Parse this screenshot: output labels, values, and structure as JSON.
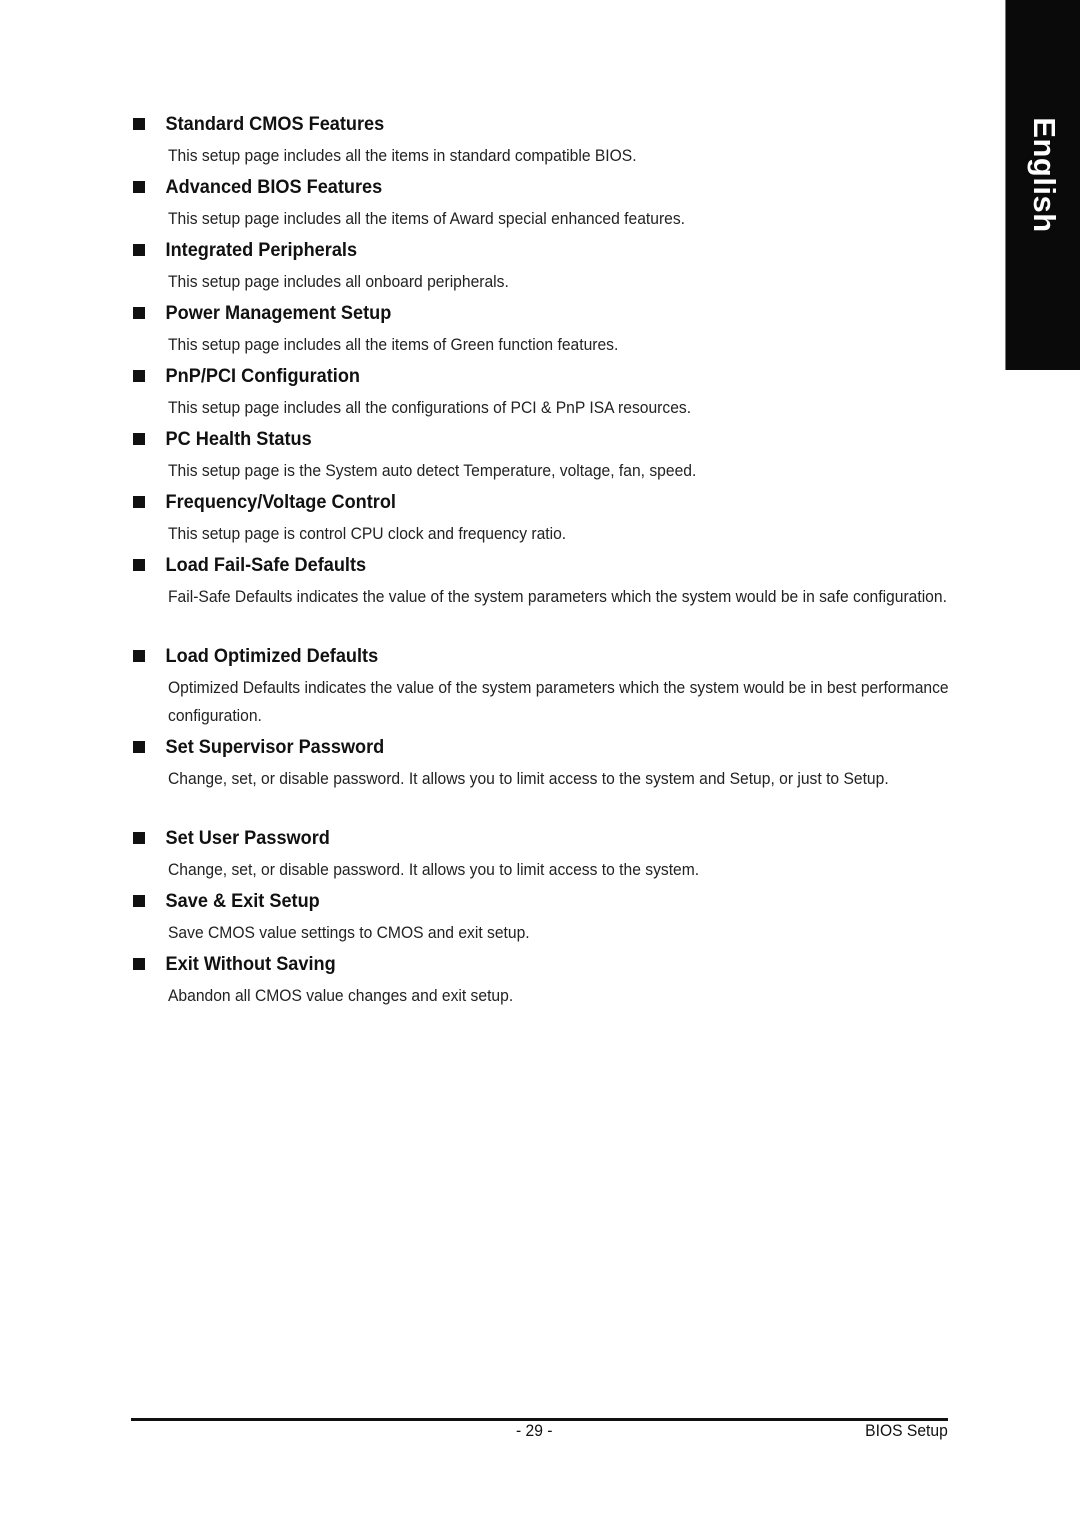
{
  "language_tab": {
    "label": "English"
  },
  "sections": [
    {
      "title": "Standard CMOS Features",
      "description": "This setup page includes all the items in standard compatible BIOS."
    },
    {
      "title": "Advanced BIOS Features",
      "description": "This setup page includes all the items of Award special enhanced features."
    },
    {
      "title": "Integrated Peripherals",
      "description": "This setup page includes all onboard peripherals."
    },
    {
      "title": "Power Management Setup",
      "description": "This setup page includes all the items of Green function features."
    },
    {
      "title": "PnP/PCI Configuration",
      "description": "This setup page includes all the configurations of PCI & PnP ISA resources."
    },
    {
      "title": "PC Health Status",
      "description": "This setup page is the System auto detect Temperature, voltage, fan, speed."
    },
    {
      "title": "Frequency/Voltage Control",
      "description": "This setup page is control CPU clock and frequency ratio."
    },
    {
      "title": "Load Fail-Safe Defaults",
      "description": "Fail-Safe Defaults indicates the value of the system parameters which the system would be in safe configuration."
    },
    {
      "title": "Load Optimized Defaults",
      "description": "Optimized Defaults indicates the value of the system parameters which the system would be in best performance configuration."
    },
    {
      "title": "Set Supervisor Password",
      "description": "Change, set, or disable password. It allows you to limit access to the system and Setup, or just to Setup."
    },
    {
      "title": "Set User Password",
      "description": "Change, set, or disable password. It allows you to limit access to the system."
    },
    {
      "title": "Save & Exit Setup",
      "description": "Save CMOS value settings to CMOS and exit setup."
    },
    {
      "title": "Exit Without Saving",
      "description": "Abandon all CMOS value changes and exit setup."
    }
  ],
  "footer": {
    "page_number": "- 29 -",
    "chapter_title": "BIOS Setup"
  }
}
